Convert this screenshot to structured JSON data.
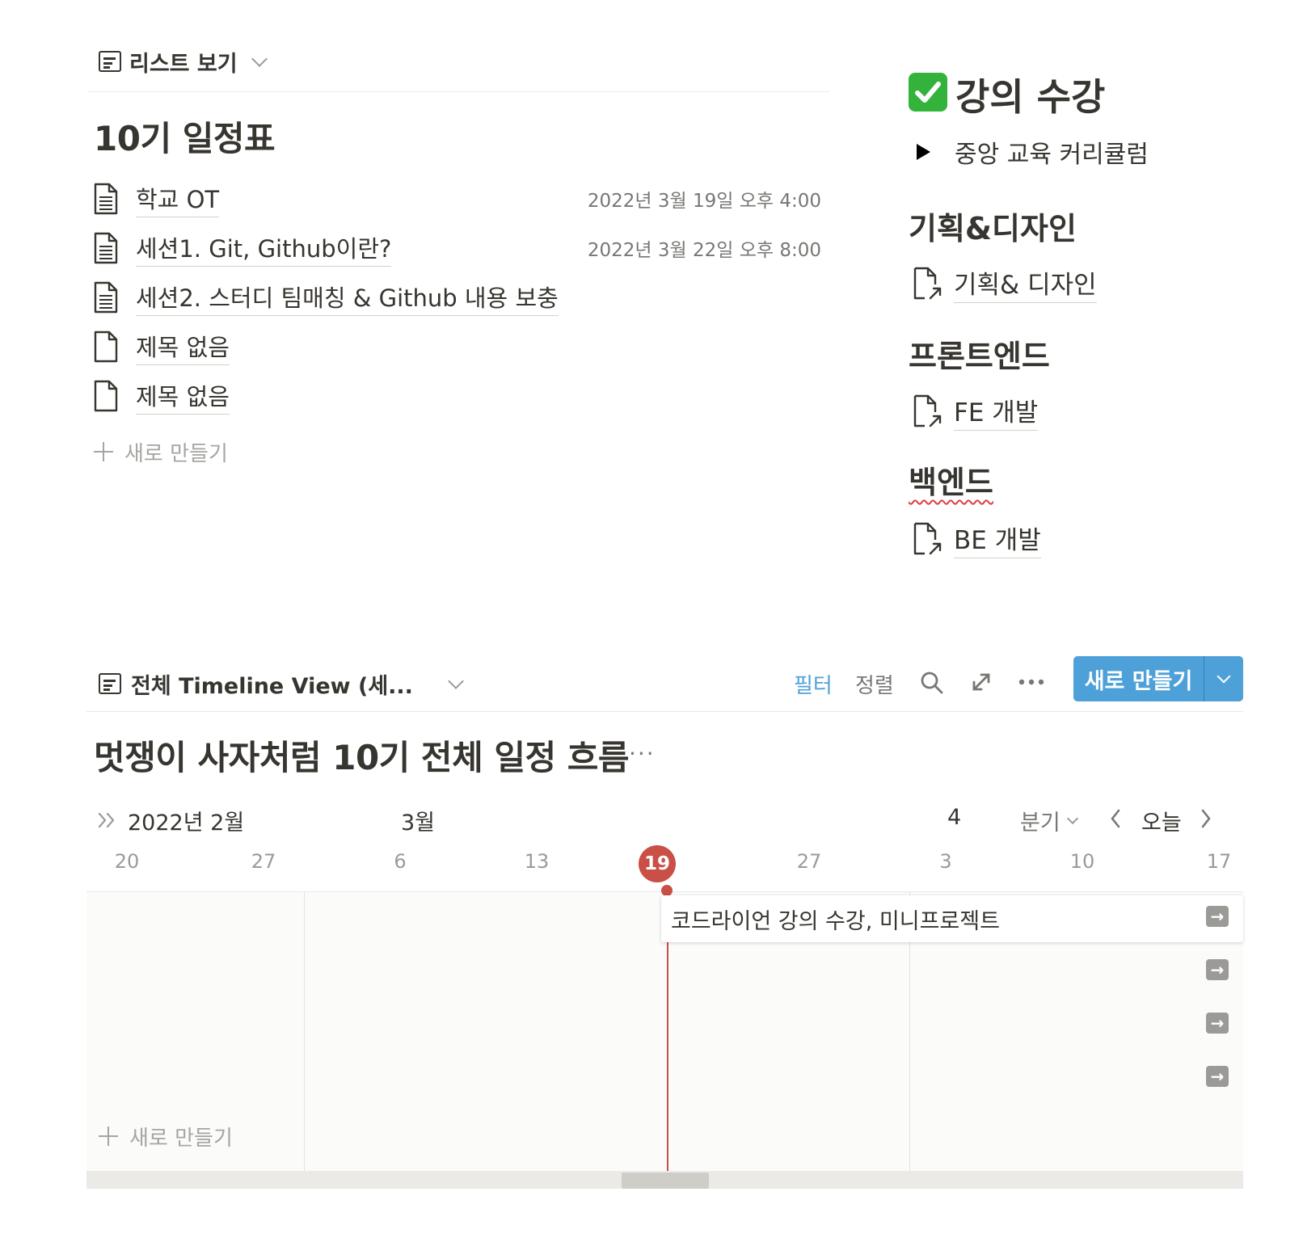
{
  "list_view": {
    "view_label": "리스트 보기",
    "title": "10기 일정표",
    "rows": [
      {
        "name": "학교 OT",
        "date": "2022년 3월 19일 오후 4:00",
        "icon": "page-text-icon"
      },
      {
        "name": "세션1. Git, Github이란?",
        "date": "2022년 3월 22일 오후 8:00",
        "icon": "page-text-icon"
      },
      {
        "name": "세션2. 스터디 팀매칭 & Github 내용 보충",
        "date": "",
        "icon": "page-text-icon"
      },
      {
        "name": "제목 없음",
        "date": "",
        "icon": "page-blank-icon"
      },
      {
        "name": "제목 없음",
        "date": "",
        "icon": "page-blank-icon"
      }
    ],
    "new_label": "새로 만들기"
  },
  "course": {
    "title": "강의 수강",
    "check_color": "#34b33c",
    "toggle_label": "중앙 교육 커리큘럼",
    "sections": [
      {
        "heading": "기획&디자인",
        "link": "기획& 디자인",
        "spell_error": false
      },
      {
        "heading": "프론트엔드",
        "link": "FE 개발",
        "spell_error": false
      },
      {
        "heading": "백엔드",
        "link": "BE 개발",
        "spell_error": true
      }
    ]
  },
  "timeline": {
    "view_label": "전체 Timeline View (세...",
    "filter_label": "필터",
    "sort_label": "정렬",
    "new_button": "새로 만들기",
    "title": "멋쟁이 사자처럼 10기 전체 일정 흐름",
    "title_menu": "···",
    "months": {
      "feb": "2022년 2월",
      "mar": "3월",
      "apr": "4"
    },
    "zoom": "분기",
    "today": "오늘",
    "days": [
      "20",
      "27",
      "6",
      "13",
      "19",
      "27",
      "3",
      "10",
      "17"
    ],
    "today_day": "19",
    "card_label": "코드라이언 강의 수강, 미니프로젝트",
    "new_label": "새로 만들기",
    "accent": "#4ea0d9",
    "today_color": "#c94f47"
  }
}
